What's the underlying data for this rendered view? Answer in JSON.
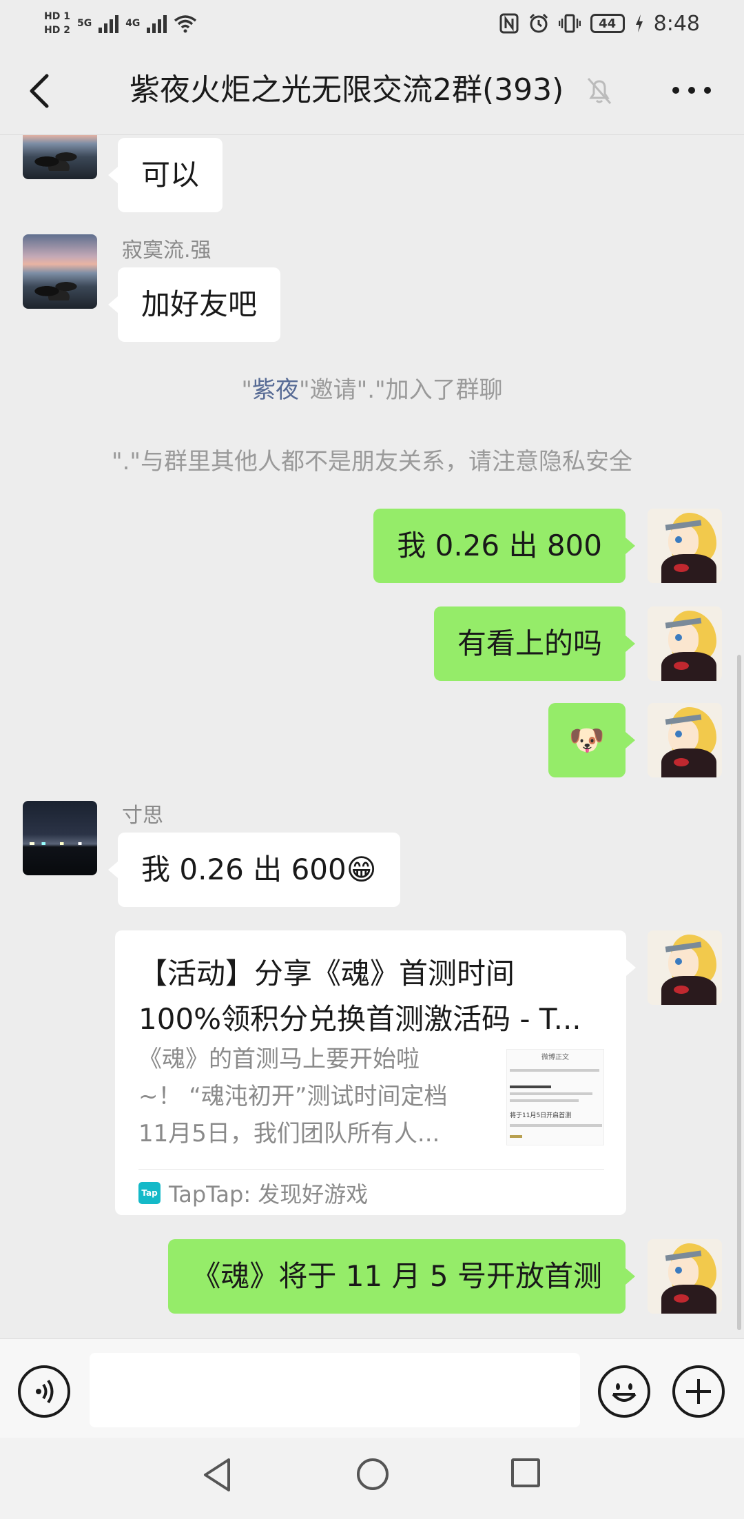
{
  "status_bar": {
    "hd1": "HD 1",
    "hd2": "HD 2",
    "net1": "5G",
    "net2": "4G",
    "battery": "44",
    "time": "8:48",
    "icons": [
      "nfc-icon",
      "alarm-icon",
      "vibrate-icon",
      "battery-icon",
      "charging-icon"
    ]
  },
  "header": {
    "title": "紫夜火炬之光无限交流2群(393)",
    "icons": [
      "back-icon",
      "muted-bell-icon",
      "more-icon"
    ]
  },
  "messages": [
    {
      "from": "other",
      "sender": "",
      "text": "可以"
    },
    {
      "from": "other",
      "sender": "寂寞流.强",
      "text": "加好友吧"
    },
    {
      "from": "other",
      "sender": "寸思",
      "text": "我 0.26 出 600😁"
    },
    {
      "from": "me",
      "text": "我 0.26 出 800"
    },
    {
      "from": "me",
      "text": "有看上的吗"
    },
    {
      "from": "me",
      "text": "🐶"
    },
    {
      "from": "me",
      "text": "《魂》将于 11 月 5 号开放首测"
    }
  ],
  "system": {
    "invite_quote1": "\"",
    "invite_name": "紫夜",
    "invite_rest": "\"邀请\".\"加入了群聊",
    "privacy": "\".\"与群里其他人都不是朋友关系，请注意隐私安全"
  },
  "card": {
    "title_line1": "【活动】分享《魂》首测时间",
    "title_line2": "100%领积分兑换首测激活码 - T...",
    "desc_line1": "《魂》的首测马上要开始啦",
    "desc_line2": "~！ “魂沌初开”测试时间定档",
    "desc_line3": "11月5日，我们团队所有人...",
    "source": "TapTap: 发现好游戏",
    "source_icon_text": "Tap",
    "thumb_title": "微博正文",
    "thumb_line": "将于11月5日开启首测"
  },
  "input": {
    "value": "",
    "icons": [
      "voice-icon",
      "emoji-icon",
      "plus-icon"
    ]
  },
  "navbar": {
    "icons": [
      "nav-back-icon",
      "nav-home-icon",
      "nav-recent-icon"
    ]
  },
  "colors": {
    "background": "#ededed",
    "my_bubble": "#95ec69",
    "other_bubble": "#ffffff",
    "link_name": "#576b95",
    "system_text": "#9a9a9a"
  }
}
